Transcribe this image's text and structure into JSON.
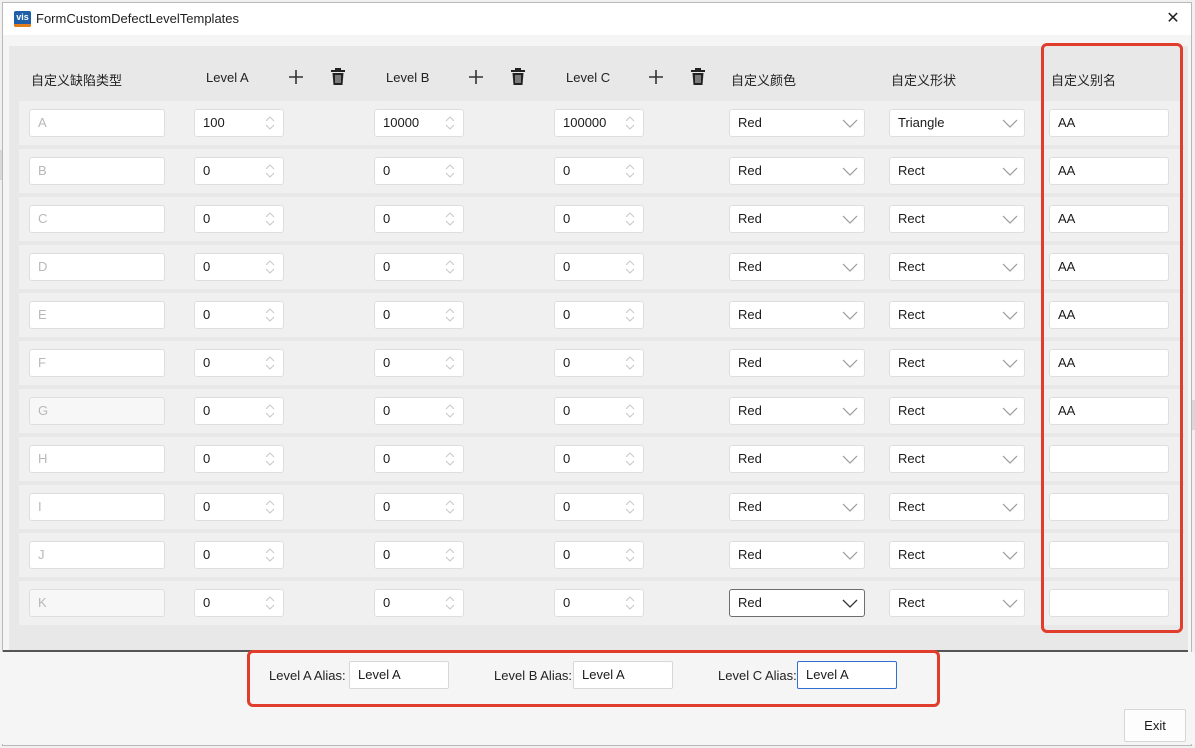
{
  "window": {
    "title": "FormCustomDefectLevelTemplates",
    "icon_text": "vis",
    "close_glyph": "✕"
  },
  "headers": {
    "type": "自定义缺陷类型",
    "level_a": "Level A",
    "level_b": "Level B",
    "level_c": "Level C",
    "color": "自定义颜色",
    "shape": "自定义形状",
    "alias": "自定义别名"
  },
  "icons": {
    "add": "plus-icon",
    "delete": "trash-icon"
  },
  "rows": [
    {
      "type": "A",
      "a": "100",
      "b": "10000",
      "c": "100000",
      "color": "Red",
      "shape": "Triangle",
      "alias": "AA"
    },
    {
      "type": "B",
      "a": "0",
      "b": "0",
      "c": "0",
      "color": "Red",
      "shape": "Rect",
      "alias": "AA"
    },
    {
      "type": "C",
      "a": "0",
      "b": "0",
      "c": "0",
      "color": "Red",
      "shape": "Rect",
      "alias": "AA"
    },
    {
      "type": "D",
      "a": "0",
      "b": "0",
      "c": "0",
      "color": "Red",
      "shape": "Rect",
      "alias": "AA"
    },
    {
      "type": "E",
      "a": "0",
      "b": "0",
      "c": "0",
      "color": "Red",
      "shape": "Rect",
      "alias": "AA"
    },
    {
      "type": "F",
      "a": "0",
      "b": "0",
      "c": "0",
      "color": "Red",
      "shape": "Rect",
      "alias": "AA"
    },
    {
      "type": "G",
      "a": "0",
      "b": "0",
      "c": "0",
      "color": "Red",
      "shape": "Rect",
      "alias": "AA"
    },
    {
      "type": "H",
      "a": "0",
      "b": "0",
      "c": "0",
      "color": "Red",
      "shape": "Rect",
      "alias": ""
    },
    {
      "type": "I",
      "a": "0",
      "b": "0",
      "c": "0",
      "color": "Red",
      "shape": "Rect",
      "alias": ""
    },
    {
      "type": "J",
      "a": "0",
      "b": "0",
      "c": "0",
      "color": "Red",
      "shape": "Rect",
      "alias": ""
    },
    {
      "type": "K",
      "a": "0",
      "b": "0",
      "c": "0",
      "color": "Red",
      "shape": "Rect",
      "alias": ""
    }
  ],
  "bottom": {
    "level_a_label": "Level A Alias:",
    "level_a_value": "Level A",
    "level_b_label": "Level B Alias:",
    "level_b_value": "Level A",
    "level_c_label": "Level C Alias:",
    "level_c_value": "Level A"
  },
  "exit_label": "Exit",
  "colors": {
    "highlight": "#e03d2d",
    "focus": "#2f6fd1"
  }
}
